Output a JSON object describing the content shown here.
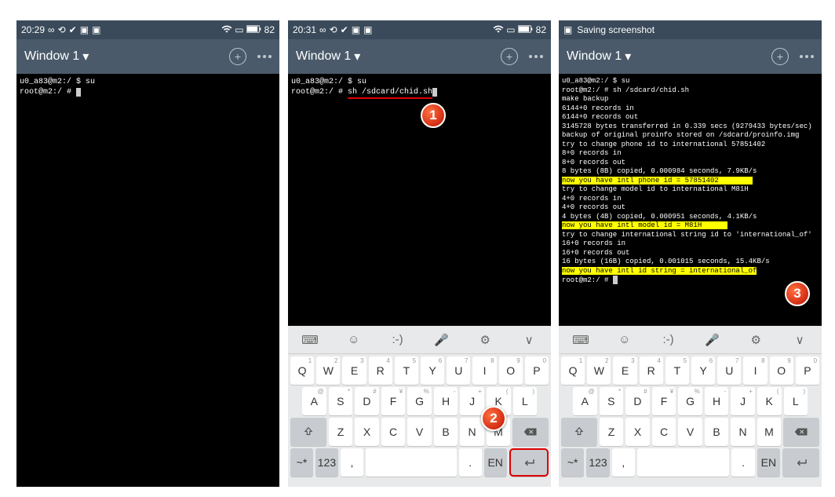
{
  "phone1": {
    "time": "20:29",
    "battery": "82",
    "window": "Window 1",
    "terminal": [
      {
        "t": "u0_a83@m2:/ $ su"
      },
      {
        "t": "root@m2:/ # ",
        "cursor": true
      }
    ]
  },
  "phone2": {
    "time": "20:31",
    "battery": "82",
    "window": "Window 1",
    "terminal": [
      {
        "t": "u0_a83@m2:/ $ su"
      },
      {
        "t": "root@m2:/ # ",
        "cmd": "sh /sdcard/chid.sh",
        "underline": true,
        "cursor": true
      }
    ]
  },
  "phone3": {
    "saving": "Saving screenshot",
    "window": "Window 1",
    "terminal": [
      {
        "t": "u0_a83@m2:/ $ su"
      },
      {
        "t": "root@m2:/ # sh /sdcard/chid.sh"
      },
      {
        "t": "make backup"
      },
      {
        "t": "6144+0 records in"
      },
      {
        "t": "6144+0 records out"
      },
      {
        "t": "3145728 bytes transferred in 0.339 secs (9279433 bytes/sec)"
      },
      {
        "t": "backup of original proinfo stored on /sdcard/proinfo.img"
      },
      {
        "t": "try to change phone id to international 57851402"
      },
      {
        "t": "8+0 records in"
      },
      {
        "t": "8+0 records out"
      },
      {
        "t": "8 bytes (8B) copied, 0.000984 seconds, 7.9KB/s"
      },
      {
        "t": "now you have intl phone id = 57851402        ",
        "hl": true
      },
      {
        "t": "try to change model id to international M81H"
      },
      {
        "t": "4+0 records in"
      },
      {
        "t": "4+0 records out"
      },
      {
        "t": "4 bytes (4B) copied, 0.000951 seconds, 4.1KB/s"
      },
      {
        "t": "now you have intl model id = M81H      ",
        "hl": true
      },
      {
        "t": "try to change international string id to 'international_of'"
      },
      {
        "t": "16+0 records in"
      },
      {
        "t": "16+0 records out"
      },
      {
        "t": "16 bytes (16B) copied, 0.001015 seconds, 15.4KB/s"
      },
      {
        "t": "now you have intl id string = international_of",
        "hl": true
      },
      {
        "t": "root@m2:/ # ",
        "cursor": true
      }
    ]
  },
  "keyboard": {
    "row1": [
      "Q",
      "W",
      "E",
      "R",
      "T",
      "Y",
      "U",
      "I",
      "O",
      "P"
    ],
    "row1_sup": [
      "1",
      "2",
      "3",
      "4",
      "5",
      "6",
      "7",
      "8",
      "9",
      "0"
    ],
    "row2": [
      "A",
      "S",
      "D",
      "F",
      "G",
      "H",
      "J",
      "K",
      "L"
    ],
    "row2_sup": [
      "@",
      "*",
      "#",
      "¥",
      "%",
      "-",
      "+",
      "(",
      ")"
    ],
    "row3": [
      "Z",
      "X",
      "C",
      "V",
      "B",
      "N",
      "M"
    ],
    "bottom": {
      "sym": "~*",
      "num": "123",
      "comma": ",",
      "dot": ".",
      "lang": "EN"
    }
  },
  "badges": {
    "b1": "1",
    "b2": "2",
    "b3": "3"
  }
}
